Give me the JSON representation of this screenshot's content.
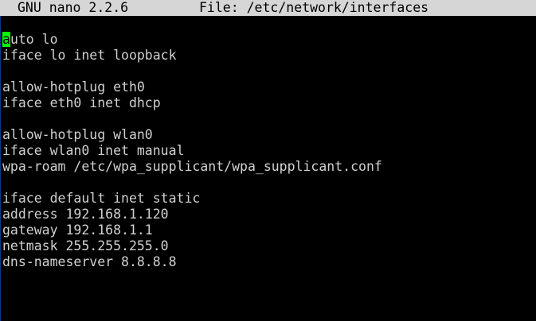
{
  "titlebar": {
    "app_version": "GNU nano 2.2.6",
    "file_label": "File: /etc/network/interfaces"
  },
  "colors": {
    "terminal_background": "#000000",
    "text": "#d0d0d0",
    "titlebar_background": "#d6d6d6",
    "cursor": "#00ff00"
  },
  "editor": {
    "cursor_char": "a",
    "first_line_rest": "uto lo",
    "lines": [
      "auto lo",
      "iface lo inet loopback",
      "",
      "allow-hotplug eth0",
      "iface eth0 inet dhcp",
      "",
      "allow-hotplug wlan0",
      "iface wlan0 inet manual",
      "wpa-roam /etc/wpa_supplicant/wpa_supplicant.conf",
      "",
      "iface default inet static",
      "address 192.168.1.120",
      "gateway 192.168.1.1",
      "netmask 255.255.255.0",
      "dns-nameserver 8.8.8.8"
    ]
  }
}
